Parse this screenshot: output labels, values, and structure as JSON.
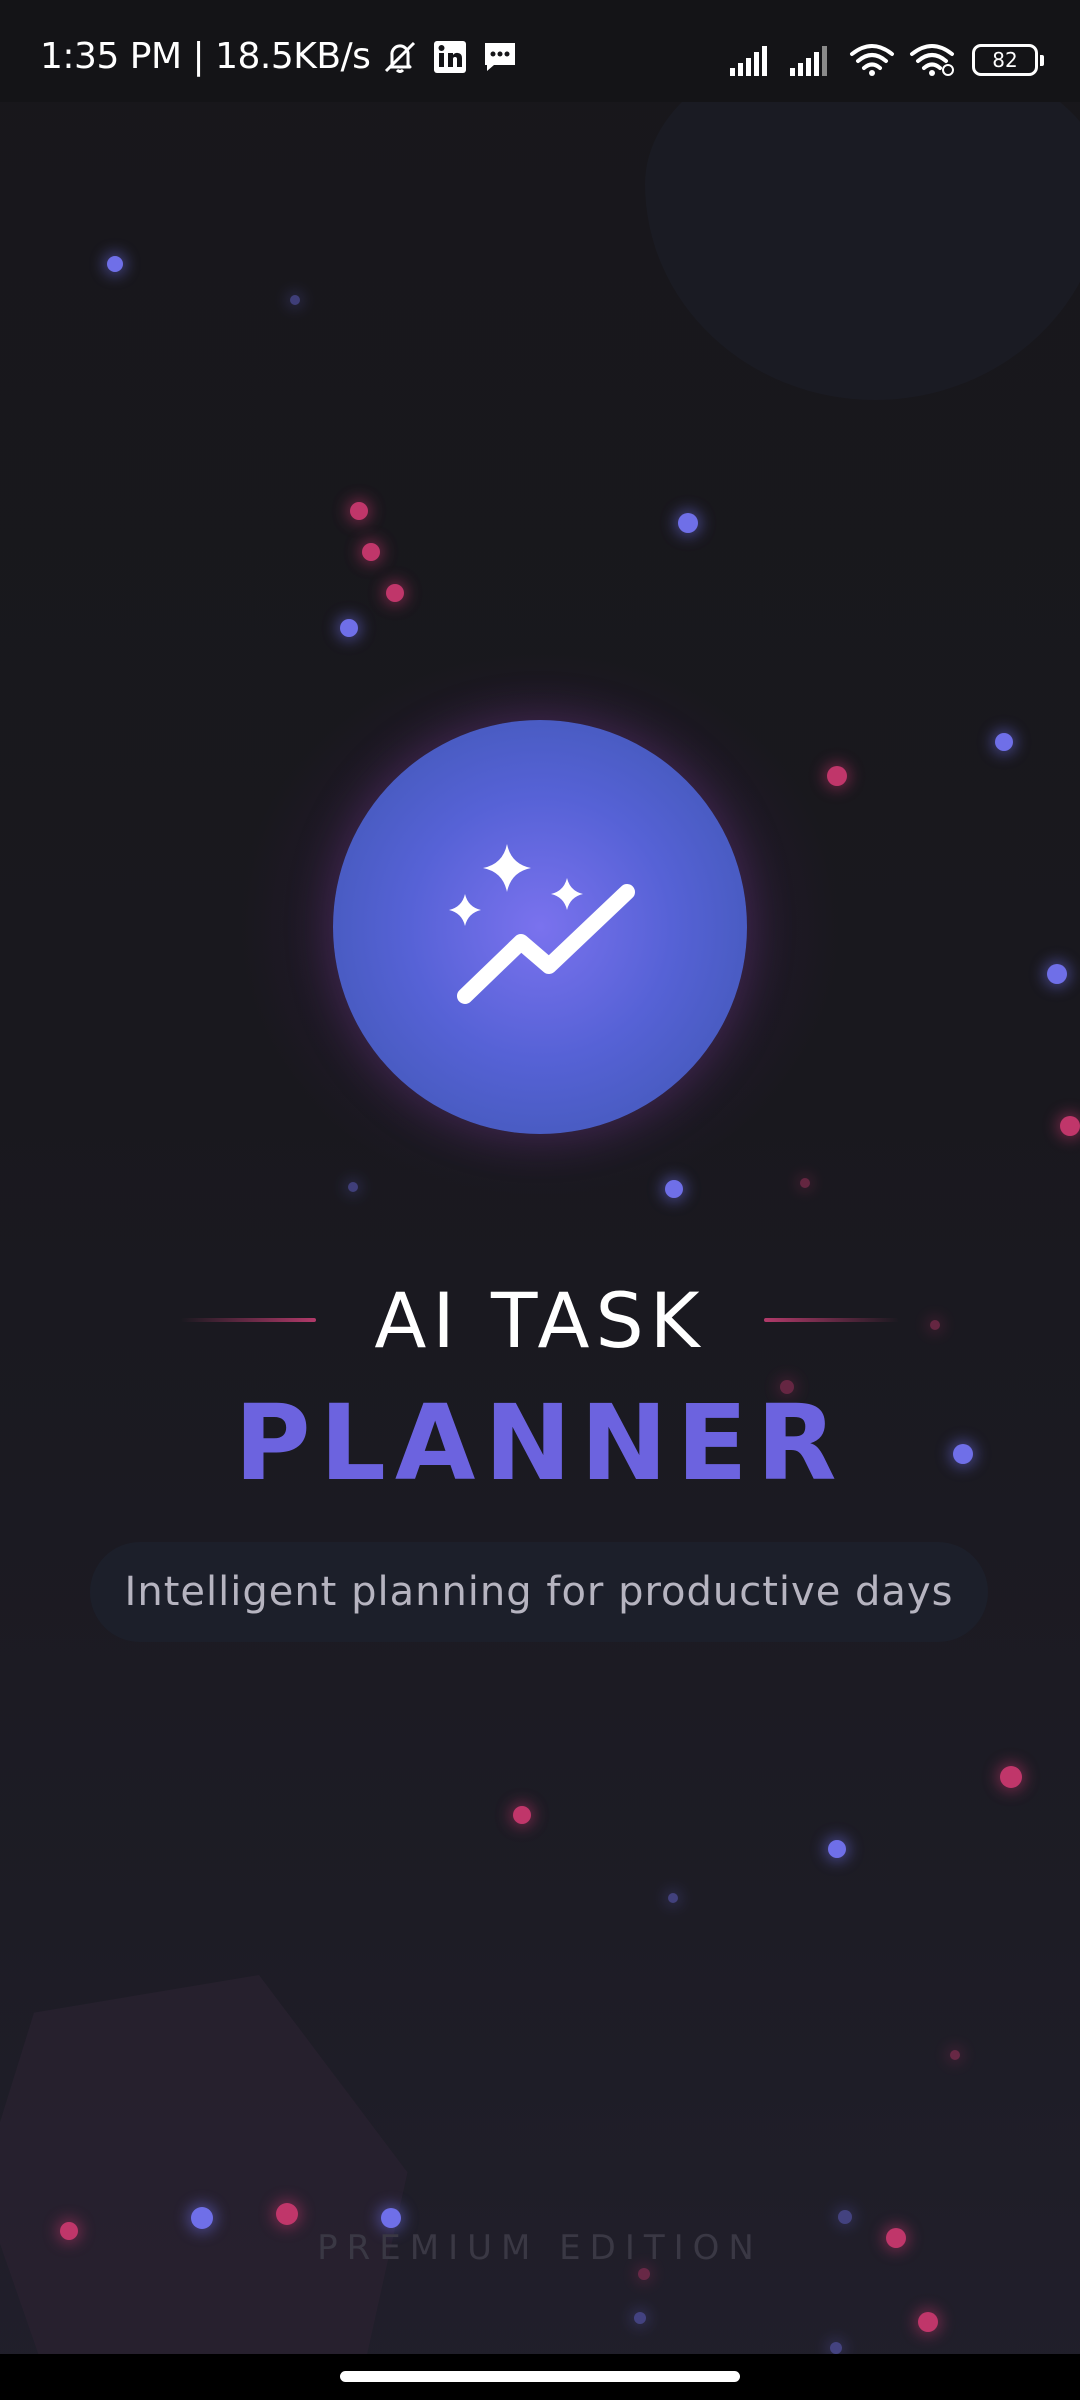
{
  "status_bar": {
    "time_speed": "1:35 PM | 18.5KB/s",
    "battery_level": "82",
    "icons": [
      "bell-off-icon",
      "linkedin-icon",
      "message-icon",
      "signal-icon",
      "signal-icon",
      "wifi-icon",
      "wifi-link-icon",
      "battery-icon"
    ]
  },
  "logo": {
    "icon": "sparkle-trend-icon",
    "colors": {
      "inner": "#7a72ee",
      "outer": "#3b55ad"
    }
  },
  "title": {
    "top": "AI TASK",
    "main": "PLANNER"
  },
  "tagline": "Intelligent planning for productive days",
  "footer": {
    "edition": "PREMIUM EDITION"
  },
  "colors": {
    "accent": "#6c63df",
    "pink": "#c0366a",
    "background": "#18171b"
  }
}
